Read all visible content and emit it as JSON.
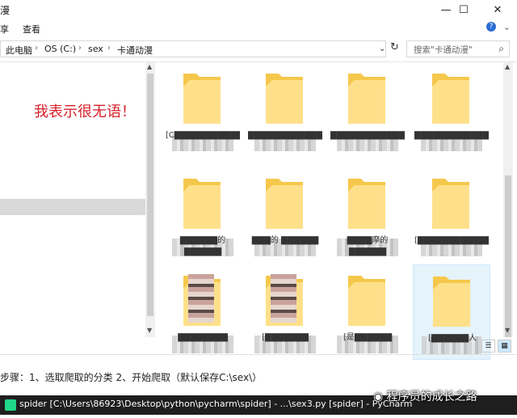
{
  "window": {
    "title": "漫",
    "controls": {
      "minimize": "—",
      "maximize": "☐",
      "close": "✕"
    }
  },
  "ribbon": {
    "tabs": [
      "享",
      "查看"
    ],
    "collapse": "⌄",
    "help": "?"
  },
  "address": {
    "crumbs": [
      "此电脑",
      "OS (C:)",
      "sex",
      "卡通动漫"
    ],
    "dropdown": "⌄",
    "refresh": "↻",
    "search_placeholder": "搜索\"卡通动漫\"",
    "search_icon": "🔍"
  },
  "left_pane": {
    "annotation": "我表示很无语！"
  },
  "content": {
    "items": [
      {
        "label": "[C▇▇▇▇▇▇▇▇▇▇▇▇▇▇▇▇▇",
        "type": "folder"
      },
      {
        "label": "▇▇▇▇▇▇▇▇▇▇▇▇",
        "type": "folder"
      },
      {
        "label": "▇▇▇▇▇▇▇▇▇▇▇▇",
        "type": "folder"
      },
      {
        "label": "▇▇▇▇▇▇▇▇▇▇▇▇",
        "type": "folder"
      },
      {
        "label": "▇▇▇▇▇▇的 ▇▇▇▇▇▇",
        "type": "folder"
      },
      {
        "label": "▇▇▇的 ▇▇▇▇▇▇",
        "type": "folder"
      },
      {
        "label": "▇▇▇▇摩的 ▇▇▇▇▇▇",
        "type": "folder"
      },
      {
        "label": "[▇▇▇▇▇▇▇▇▇▇▇▇",
        "type": "folder"
      },
      {
        "label": "▇▇▇▇▇▇▇▇",
        "type": "folder-image"
      },
      {
        "label": "[▇▇▇▇▇▇▇",
        "type": "folder-image"
      },
      {
        "label": "[是▇▇▇▇▇▇",
        "type": "folder"
      },
      {
        "label": "[▇▇▇▇▇▇人",
        "type": "folder",
        "selected": true
      }
    ]
  },
  "view_buttons": {
    "details": "☰",
    "large": "▦"
  },
  "steps_text": "步骤：1、选取爬取的分类 2、开始爬取（默认保存C:\\sex\\）",
  "taskbar": {
    "text": "spider [C:\\Users\\86923\\Desktop\\python\\pycharm\\spider] - ...\\sex3.py [spider] - PyCharm"
  },
  "watermark": "程序员的成长之路",
  "colors": {
    "folder_yellow": "#f5c84c",
    "folder_light": "#ffe08a",
    "annotation_red": "#d6202a",
    "selection": "#e5f3fb",
    "taskbar": "#1e1e1e",
    "help_blue": "#2b6cd4"
  }
}
